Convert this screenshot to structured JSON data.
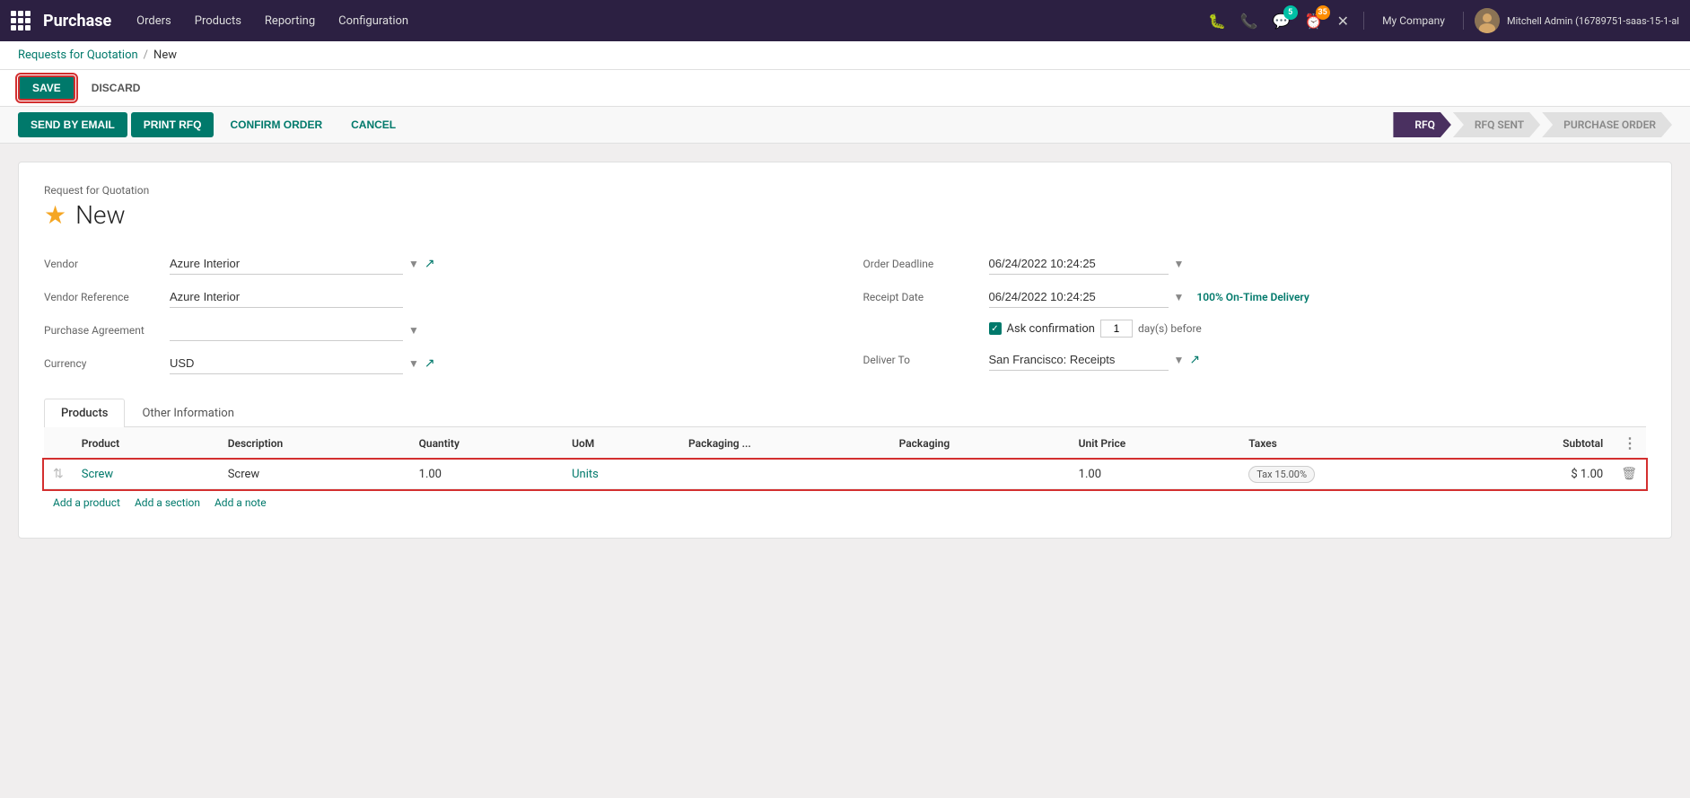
{
  "app": {
    "name": "Purchase",
    "grid_icon": true
  },
  "topnav": {
    "menu_items": [
      "Orders",
      "Products",
      "Reporting",
      "Configuration"
    ],
    "company": "My Company",
    "user": "Mitchell Admin (16789751-saas-15-1-al",
    "chat_badge": "5",
    "clock_badge": "35"
  },
  "breadcrumb": {
    "parent": "Requests for Quotation",
    "separator": "/",
    "current": "New"
  },
  "action_bar": {
    "save_label": "SAVE",
    "discard_label": "DISCARD"
  },
  "toolbar": {
    "send_email_label": "SEND BY EMAIL",
    "print_rfq_label": "PRINT RFQ",
    "confirm_order_label": "CONFIRM ORDER",
    "cancel_label": "CANCEL"
  },
  "pipeline": {
    "steps": [
      "RFQ",
      "RFQ SENT",
      "PURCHASE ORDER"
    ],
    "active_index": 0
  },
  "form": {
    "header_label": "Request for Quotation",
    "title": "New",
    "star": "★",
    "fields_left": [
      {
        "label": "Vendor",
        "value": "Azure Interior",
        "has_dropdown": true,
        "has_link": true
      },
      {
        "label": "Vendor Reference",
        "value": "Azure Interior",
        "has_dropdown": false,
        "has_link": false
      },
      {
        "label": "Purchase Agreement",
        "value": "",
        "has_dropdown": true,
        "has_link": false
      },
      {
        "label": "Currency",
        "value": "USD",
        "has_dropdown": true,
        "has_link": true
      }
    ],
    "fields_right": [
      {
        "label": "Order Deadline",
        "value": "06/24/2022 10:24:25",
        "has_dropdown": true,
        "has_link": false,
        "extra": ""
      },
      {
        "label": "Receipt Date",
        "value": "06/24/2022 10:24:25",
        "has_dropdown": true,
        "has_link": false,
        "extra": "100% On-Time Delivery"
      },
      {
        "label": "",
        "value": "",
        "is_confirmation": true,
        "conf_label": "Ask confirmation",
        "conf_value": "1",
        "conf_suffix": "day(s) before"
      },
      {
        "label": "Deliver To",
        "value": "San Francisco: Receipts",
        "has_dropdown": true,
        "has_link": true,
        "extra": ""
      }
    ]
  },
  "tabs": {
    "items": [
      "Products",
      "Other Information"
    ],
    "active": "Products"
  },
  "products_table": {
    "columns": [
      "Product",
      "Description",
      "Quantity",
      "UoM",
      "Packaging ...",
      "Packaging",
      "Unit Price",
      "Taxes",
      "Subtotal"
    ],
    "rows": [
      {
        "product": "Screw",
        "description": "Screw",
        "quantity": "1.00",
        "uom": "Units",
        "packaging_qty": "",
        "packaging": "",
        "unit_price": "1.00",
        "taxes": "Tax 15.00%",
        "subtotal": "$ 1.00",
        "highlighted": true
      }
    ],
    "add_links": [
      "Add a product",
      "Add a section",
      "Add a note"
    ]
  }
}
